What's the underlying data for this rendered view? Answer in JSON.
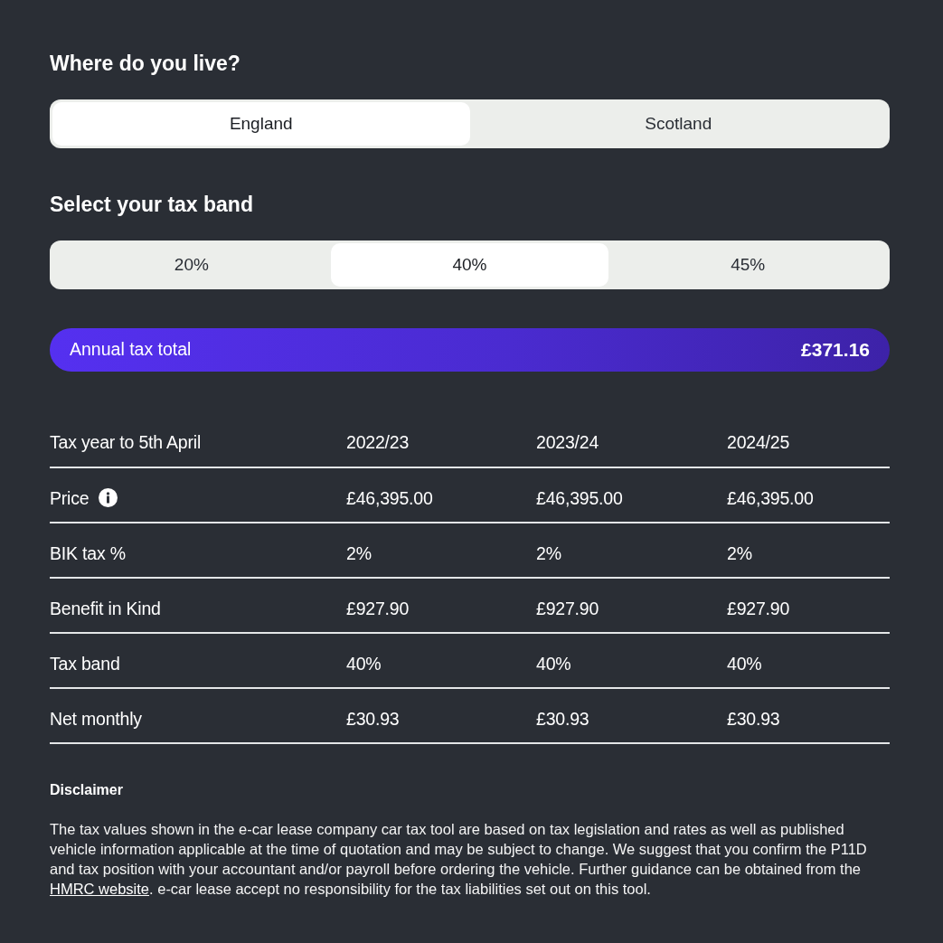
{
  "location": {
    "title": "Where do you live?",
    "options": [
      {
        "label": "England",
        "selected": true
      },
      {
        "label": "Scotland",
        "selected": false
      }
    ]
  },
  "tax_band": {
    "title": "Select your tax band",
    "options": [
      {
        "label": "20%",
        "selected": false
      },
      {
        "label": "40%",
        "selected": true
      },
      {
        "label": "45%",
        "selected": false
      }
    ]
  },
  "annual_total": {
    "label": "Annual tax total",
    "value": "£371.16"
  },
  "table": {
    "columns": [
      "Tax year to 5th April",
      "2022/23",
      "2023/24",
      "2024/25"
    ],
    "rows": [
      {
        "info": true,
        "cells": [
          "Price",
          "£46,395.00",
          "£46,395.00",
          "£46,395.00"
        ]
      },
      {
        "info": false,
        "cells": [
          "BIK tax %",
          "2%",
          "2%",
          "2%"
        ]
      },
      {
        "info": false,
        "cells": [
          "Benefit in Kind",
          "£927.90",
          "£927.90",
          "£927.90"
        ]
      },
      {
        "info": false,
        "cells": [
          "Tax band",
          "40%",
          "40%",
          "40%"
        ]
      },
      {
        "info": false,
        "cells": [
          "Net monthly",
          "£30.93",
          "£30.93",
          "£30.93"
        ]
      }
    ]
  },
  "disclaimer": {
    "title": "Disclaimer",
    "text_before": "The tax values shown in the e-car lease company car tax tool are based on tax legislation and rates as well as published vehicle information applicable at the time of quotation and may be subject to change. We suggest that you confirm the P11D and tax position with your accountant and/or payroll before ordering the vehicle. Further guidance can be obtained from the ",
    "link": "HMRC website",
    "text_after": ". e-car lease accept no responsibility for the tax liabilities set out on this tool."
  }
}
